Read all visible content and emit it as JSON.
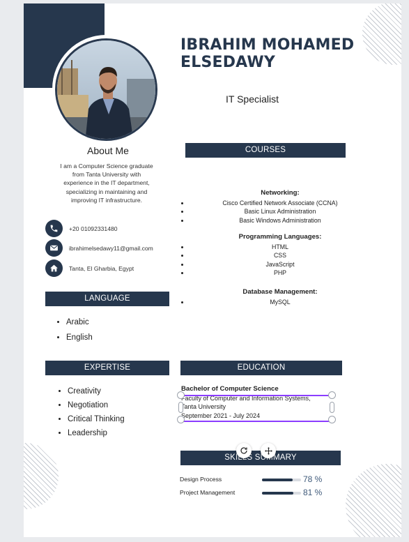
{
  "resume": {
    "name_line1": "IBRAHIM MOHAMED",
    "name_line2": "ELSEDAWY",
    "job_title": "IT Specialist",
    "about": {
      "title": "About Me",
      "text": "I am a Computer Science graduate from Tanta University with experience in the IT department, specializing in maintaining and improving IT infrastructure."
    },
    "contacts": [
      {
        "icon": "phone-icon",
        "text": "+20 01092331480"
      },
      {
        "icon": "email-icon",
        "text": "ibrahimelsedawy11@gmail.com"
      },
      {
        "icon": "home-icon",
        "text": "Tanta, El Gharbia, Egypt"
      }
    ],
    "sections": {
      "courses": "COURSES",
      "language": "LANGUAGE",
      "expertise": "EXPERTISE",
      "education": "EDUCATION",
      "skills": "SKILLS SUMMARY"
    },
    "languages": [
      "Arabic",
      "English"
    ],
    "expertise": [
      "Creativity",
      "Negotiation",
      "Critical Thinking",
      "Leadership"
    ],
    "courses": {
      "networking": {
        "heading": "Networking:",
        "items": [
          "Cisco Certified Network Associate (CCNA)",
          "Basic Linux Administration",
          "Basic Windows Administration"
        ]
      },
      "programming": {
        "heading": "Programming Languages:",
        "items": [
          "HTML",
          "CSS",
          "JavaScript",
          "PHP"
        ]
      },
      "database": {
        "heading": "Database Management:",
        "items": [
          "MySQL"
        ]
      }
    },
    "education": {
      "degree": "Bachelor of Computer Science",
      "faculty": "Faculty of Computer and Information Systems,",
      "university": "Tanta University",
      "dates": "September 2021 - July 2024"
    },
    "skills": [
      {
        "label": "Design Process",
        "percent_text": "78 %",
        "level": 0.78
      },
      {
        "label": "Project Management",
        "percent_text": "81 %",
        "level": 0.81
      }
    ]
  },
  "editor": {
    "rotate_icon": "rotate-icon",
    "move_icon": "move-icon"
  },
  "colors": {
    "navy": "#26374d",
    "selection": "#8b3dff",
    "canvas_bg": "#e9ebee"
  }
}
